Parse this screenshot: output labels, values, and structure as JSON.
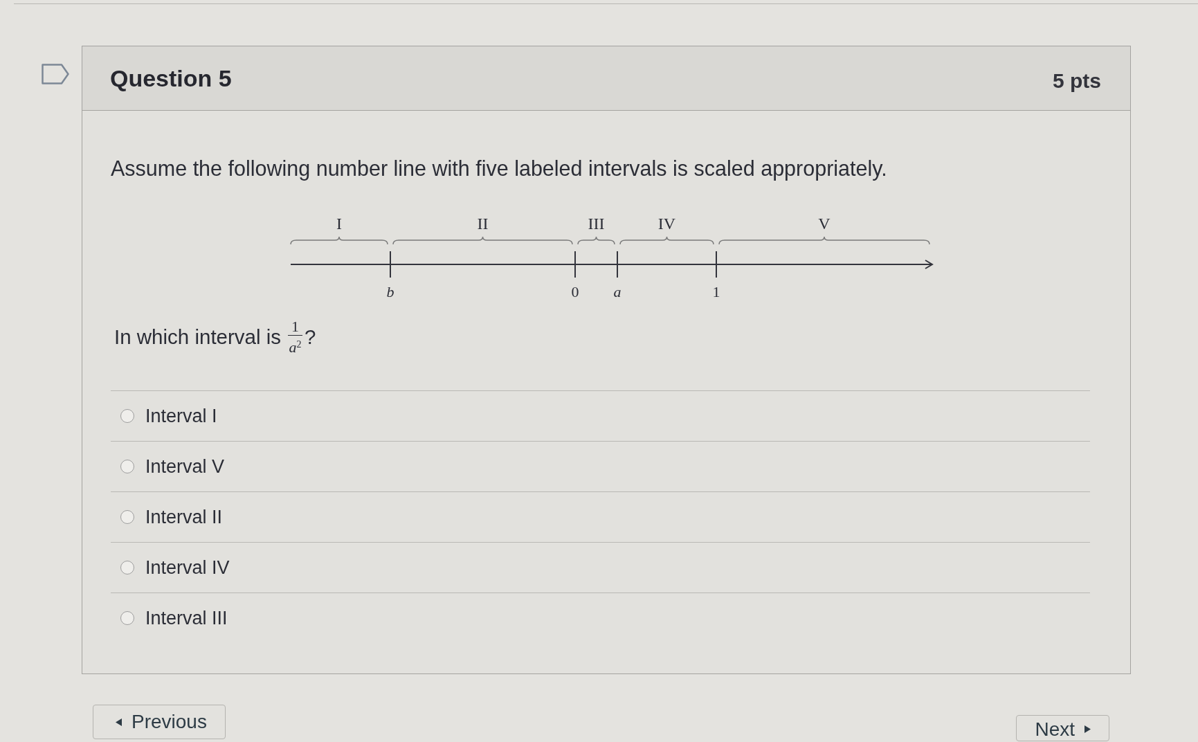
{
  "question": {
    "title": "Question 5",
    "points": "5 pts",
    "text": "Assume the following number line with five labeled intervals is scaled appropriately.",
    "number_line": {
      "intervals": [
        {
          "label": "I"
        },
        {
          "label": "II"
        },
        {
          "label": "III"
        },
        {
          "label": "IV"
        },
        {
          "label": "V"
        }
      ],
      "points": [
        {
          "label": "b",
          "kind": "variable"
        },
        {
          "label": "0",
          "kind": "number"
        },
        {
          "label": "a",
          "kind": "variable"
        },
        {
          "label": "1",
          "kind": "number"
        }
      ]
    },
    "prompt": {
      "before": "In which interval is",
      "numerator": "1",
      "denominator": "*a*$^{2}$",
      "after": "?"
    },
    "answers": [
      {
        "label": "Interval I",
        "selected": false
      },
      {
        "label": "Interval V",
        "selected": false
      },
      {
        "label": "Interval II",
        "selected": false
      },
      {
        "label": "Interval IV",
        "selected": false
      },
      {
        "label": "Interval III",
        "selected": false
      }
    ]
  },
  "navigation": {
    "previous": "Previous",
    "next": "Next"
  }
}
